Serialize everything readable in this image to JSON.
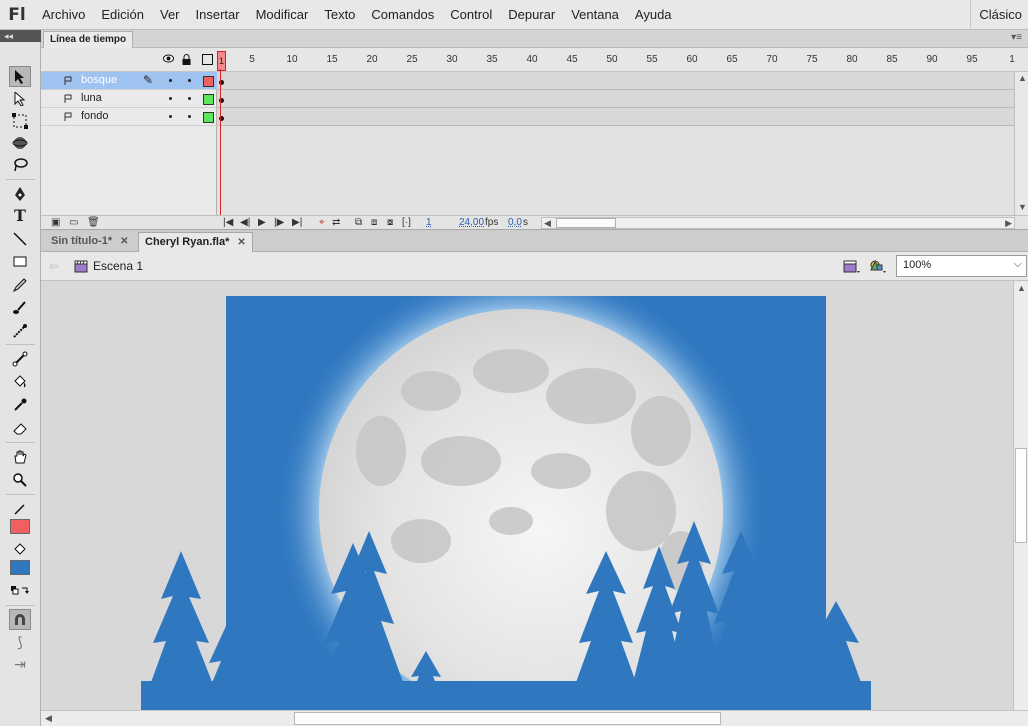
{
  "app": {
    "logo": "Fl",
    "workspace": "Clásico"
  },
  "menu": [
    "Archivo",
    "Edición",
    "Ver",
    "Insertar",
    "Modificar",
    "Texto",
    "Comandos",
    "Control",
    "Depurar",
    "Ventana",
    "Ayuda"
  ],
  "timeline": {
    "panel_title": "Línea de tiempo",
    "ruler_ticks": [
      "1",
      "5",
      "10",
      "15",
      "20",
      "25",
      "30",
      "35",
      "40",
      "45",
      "50",
      "55",
      "60",
      "65",
      "70",
      "75",
      "80",
      "85",
      "90",
      "95",
      "1"
    ],
    "layers": [
      {
        "name": "bosque",
        "color": "#f06060",
        "selected": true
      },
      {
        "name": "luna",
        "color": "#5ce65c",
        "selected": false
      },
      {
        "name": "fondo",
        "color": "#5ce65c",
        "selected": false
      }
    ],
    "current_frame": "1",
    "fps": "24,00",
    "fps_unit": "fps",
    "time": "0,0",
    "time_unit": "s"
  },
  "documents": {
    "tabs": [
      {
        "label": "Sin título-1*",
        "active": false
      },
      {
        "label": "Cheryl Ryan.fla*",
        "active": true
      }
    ]
  },
  "scene": {
    "label": "Escena 1"
  },
  "zoom": {
    "value": "100%"
  },
  "colors": {
    "stroke": "#f06060",
    "fill": "#2f78c0",
    "stage_bg": "#2f78c0",
    "moon": "#e2e2e2"
  },
  "tools": [
    "selection-tool",
    "subselection-tool",
    "free-transform-tool",
    "3d-rotation-tool",
    "lasso-tool",
    "pen-tool",
    "text-tool",
    "line-tool",
    "rectangle-tool",
    "pencil-tool",
    "brush-tool",
    "deco-tool",
    "bone-tool",
    "paint-bucket-tool",
    "eyedropper-tool",
    "eraser-tool",
    "hand-tool",
    "zoom-tool"
  ]
}
